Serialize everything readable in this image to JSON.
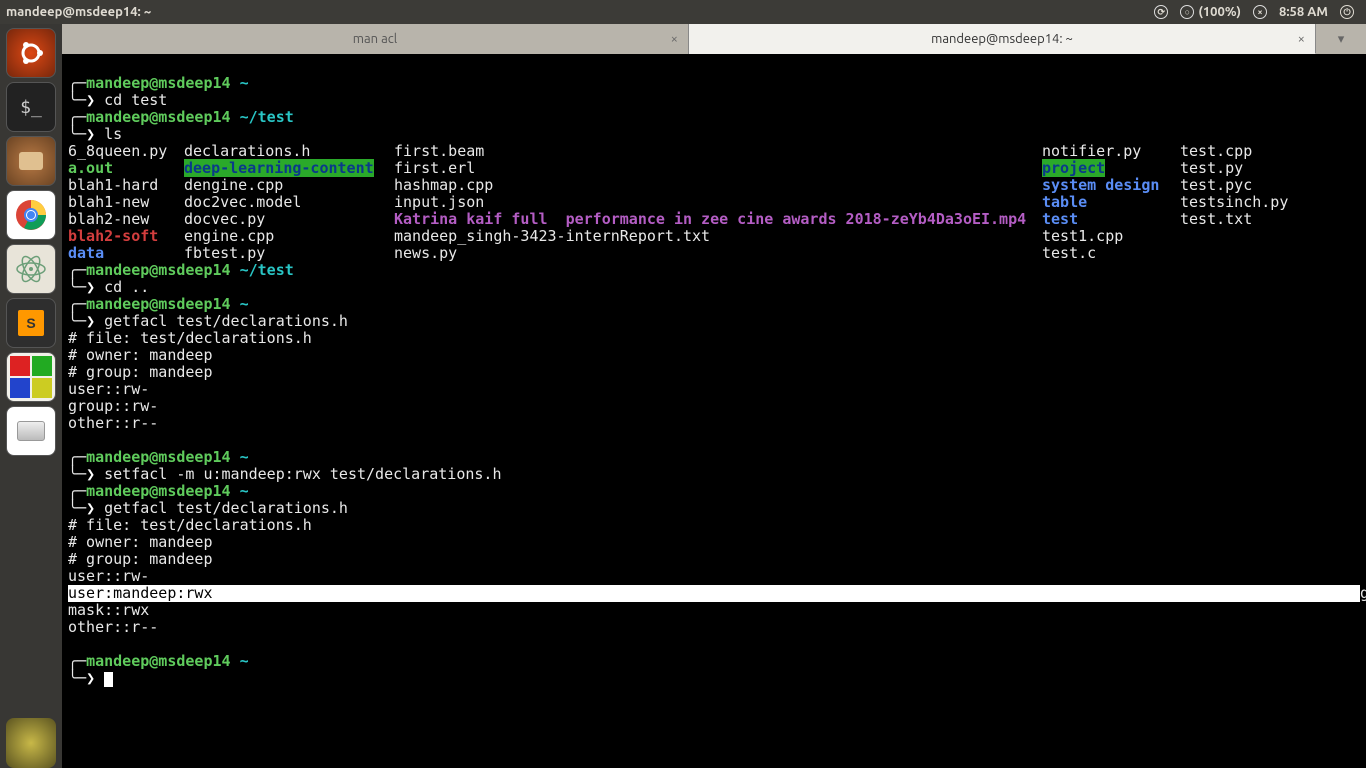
{
  "top_panel": {
    "title": "mandeep@msdeep14: ~",
    "battery": "(100%)",
    "time": "8:58 AM"
  },
  "launcher": {
    "items": [
      "ubuntu-dash",
      "terminal",
      "software-center",
      "chrome",
      "atom",
      "sublime",
      "four-color",
      "files",
      "trash"
    ]
  },
  "tabs": {
    "items": [
      {
        "label": "man acl",
        "active": false
      },
      {
        "label": "mandeep@msdeep14: ~",
        "active": true
      }
    ]
  },
  "colors": {
    "prompt_user": "#5fcb5c",
    "prompt_path": "#29c5c5",
    "dir": "#5a8df5",
    "symlink": "#d33e3e",
    "media": "#b45dc4"
  },
  "prompt": {
    "user_host": "mandeep@msdeep14",
    "home": "~",
    "testpath": "~/test",
    "arrow": "❯"
  },
  "commands": {
    "cd_test": "cd test",
    "ls": "ls",
    "cd_up": "cd ..",
    "getfacl": "getfacl test/declarations.h",
    "setfacl": "setfacl -m u:mandeep:rwx test/declarations.h"
  },
  "ls": {
    "col1": [
      "6_8queen.py",
      "a.out",
      "blah1-hard",
      "blah1-new",
      "blah2-new",
      "blah2-soft",
      "data"
    ],
    "col2": [
      "declarations.h",
      "deep-learning-content",
      "dengine.cpp",
      "doc2vec.model",
      "docvec.py",
      "engine.cpp",
      "fbtest.py"
    ],
    "col3": [
      "first.beam",
      "first.erl",
      "hashmap.cpp",
      "input.json",
      "Katrina kaif full  performance in zee cine awards 2018-zeYb4Da3oEI.mp4",
      "mandeep_singh-3423-internReport.txt",
      "news.py"
    ],
    "col4": [
      "notifier.py",
      "project",
      "system design",
      "table",
      "test",
      "test1.cpp",
      "test.c"
    ],
    "col5": [
      "test.cpp",
      "test.py",
      "test.pyc",
      "testsinch.py",
      "test.txt"
    ]
  },
  "facl1": {
    "file": "# file: test/declarations.h",
    "owner": "# owner: mandeep",
    "group": "# group: mandeep",
    "user": "user::rw-",
    "grp": "group::rw-",
    "other": "other::r--"
  },
  "facl2": {
    "file": "# file: test/declarations.h",
    "owner": "# owner: mandeep",
    "group": "# group: mandeep",
    "user": "user::rw-",
    "user_m": "user:mandeep:rwx",
    "grp": "group::rw-",
    "mask": "mask::rwx",
    "other": "other::r--"
  }
}
